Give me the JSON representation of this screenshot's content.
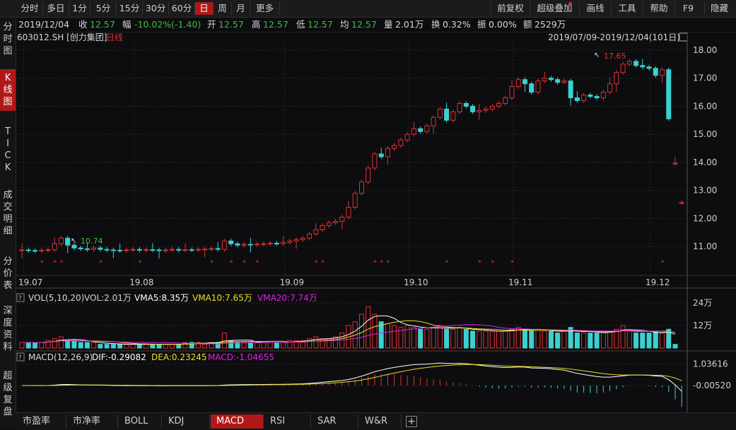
{
  "toolbar": {
    "periods": [
      "分时",
      "多日",
      "1分",
      "5分",
      "15分",
      "30分",
      "60分",
      "日",
      "周",
      "月",
      "更多"
    ],
    "active_period": "日",
    "right_buttons": [
      "前复权",
      "超级叠加",
      "画线",
      "工具",
      "帮助",
      "F9",
      "隐藏"
    ]
  },
  "quote": {
    "date": "2019/12/04",
    "close_label": "收",
    "close": "12.57",
    "change_label": "幅",
    "change": "-10.02%(-1.40)",
    "open_label": "开",
    "open": "12.57",
    "high_label": "高",
    "high": "12.57",
    "low_label": "低",
    "low": "12.57",
    "avg_label": "均",
    "avg": "12.57",
    "volume_label": "量",
    "volume": "2.01万",
    "turnover_label": "换",
    "turnover": "0.32%",
    "amplitude_label": "振",
    "amplitude": "0.00%",
    "amount_label": "额",
    "amount": "2529万"
  },
  "left_tabs": [
    "分时图",
    "K线图",
    "TICK",
    "成交明细",
    "分价表",
    "深度资料",
    "超级复盘"
  ],
  "active_left_tab": "K线图",
  "main_panel": {
    "stock": "603012.SH [创力集团]",
    "period_tag": "日线",
    "range": "2019/07/09-2019/12/04(101日)",
    "high_marker": "17.65",
    "low_marker": "10.74",
    "y_ticks": [
      "18.00",
      "17.00",
      "16.00",
      "15.00",
      "14.00",
      "13.00",
      "12.00",
      "11.00"
    ],
    "x_ticks": [
      "19.07",
      "19.08",
      "19.09",
      "19.10",
      "19.11",
      "19.12"
    ]
  },
  "volume_panel": {
    "header": "VOL(5,10,20)",
    "vol": "VOL:2.01万",
    "vma5": "VMA5:8.35万",
    "vma10": "VMA10:7.65万",
    "vma20": "VMA20:7.74万",
    "y_ticks": [
      "24万",
      "12万"
    ]
  },
  "macd_panel": {
    "header": "MACD(12,26,9)",
    "dif": "DIF:-0.29082",
    "dea": "DEA:0.23245",
    "macd": "MACD:-1.04655",
    "y_ticks": [
      "1.03616",
      "-0.00520"
    ]
  },
  "bottom_tabs": [
    "市盈率",
    "市净率",
    "BOLL",
    "KDJ",
    "MACD",
    "RSI",
    "SAR",
    "W&R"
  ],
  "active_bottom_tab": "MACD",
  "colors": {
    "up": "#e03030",
    "down": "#3ad1d1",
    "macd_up": "#e03030",
    "macd_down": "#3ad1d1",
    "bg": "#0d0d0f",
    "grid": "#262626",
    "accent_red": "#b01818"
  },
  "chart_data": {
    "type": "candlestick",
    "price_range": [
      10.1,
      18.3
    ],
    "closes": [
      10.88,
      10.86,
      10.85,
      10.87,
      10.89,
      11.1,
      11.3,
      11.05,
      10.95,
      10.92,
      10.9,
      10.95,
      10.9,
      10.88,
      10.87,
      10.86,
      10.88,
      10.9,
      10.87,
      10.89,
      10.88,
      10.86,
      10.88,
      10.9,
      10.87,
      10.89,
      10.88,
      10.9,
      10.91,
      10.93,
      10.9,
      11.2,
      11.1,
      11.05,
      11.08,
      11.07,
      11.09,
      11.1,
      11.12,
      11.1,
      11.15,
      11.2,
      11.25,
      11.3,
      11.45,
      11.6,
      11.75,
      11.85,
      11.9,
      12.05,
      12.4,
      12.9,
      13.3,
      13.8,
      14.3,
      14.2,
      14.5,
      14.6,
      14.8,
      15.0,
      15.2,
      15.1,
      15.3,
      15.6,
      15.9,
      15.5,
      15.8,
      16.1,
      16.0,
      15.8,
      15.85,
      15.9,
      16.0,
      16.1,
      16.3,
      16.7,
      16.95,
      16.8,
      16.5,
      16.9,
      17.0,
      16.95,
      16.85,
      16.9,
      16.3,
      16.2,
      16.4,
      16.35,
      16.3,
      16.5,
      16.8,
      17.2,
      17.5,
      17.6,
      17.45,
      17.4,
      17.35,
      17.1,
      17.3,
      15.55,
      13.97,
      12.57
    ],
    "volume_range": [
      0,
      27
    ],
    "volumes": [
      3,
      3,
      3,
      3,
      4,
      5,
      6,
      4,
      4,
      3,
      3,
      3,
      2,
      2,
      2,
      2,
      2,
      2,
      2,
      2,
      2,
      2,
      2,
      2,
      2,
      3,
      3,
      3,
      2,
      3,
      3,
      8,
      4,
      3,
      3,
      3,
      3,
      3,
      3,
      3,
      3,
      4,
      4,
      4,
      5,
      6,
      5,
      5,
      6,
      8,
      12,
      14,
      18,
      22,
      18,
      14,
      13,
      12,
      11,
      12,
      11,
      10,
      10,
      11,
      12,
      10,
      10,
      11,
      10,
      9,
      9,
      9,
      9,
      9,
      9,
      10,
      11,
      10,
      9,
      10,
      9,
      9,
      8,
      9,
      11,
      8,
      8,
      8,
      8,
      9,
      9,
      10,
      12,
      9,
      8,
      8,
      8,
      9,
      8,
      10,
      2
    ]
  }
}
